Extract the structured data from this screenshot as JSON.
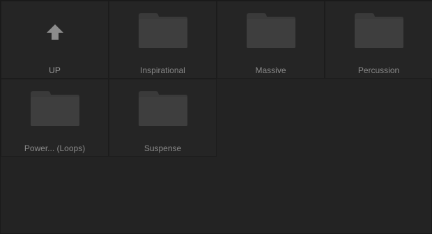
{
  "browser": {
    "items": [
      {
        "label": "UP",
        "icon": "up-arrow-icon"
      },
      {
        "label": "Inspirational",
        "icon": "folder-icon"
      },
      {
        "label": "Massive",
        "icon": "folder-icon"
      },
      {
        "label": "Percussion",
        "icon": "folder-icon"
      },
      {
        "label": "Power... (Loops)",
        "icon": "folder-icon"
      },
      {
        "label": "Suspense",
        "icon": "folder-icon"
      }
    ]
  },
  "colors": {
    "background": "#232323",
    "tile": "#252525",
    "folder": "#3b3b3b",
    "label": "#8a8a8a",
    "up_arrow": "#8c8c8c"
  }
}
